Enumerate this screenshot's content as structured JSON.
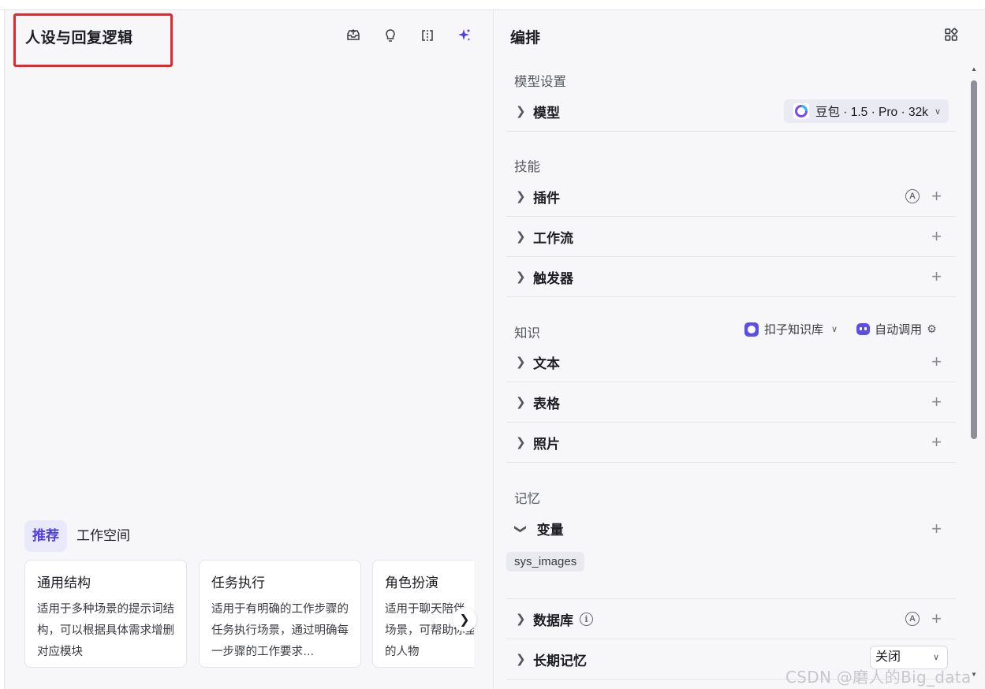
{
  "left": {
    "title": "人设与回复逻辑",
    "tabs": [
      "推荐",
      "工作空间"
    ],
    "cards": [
      {
        "title": "通用结构",
        "desc": "适用于多种场景的提示词结构，可以根据具体需求增删对应模块"
      },
      {
        "title": "任务执行",
        "desc": "适用于有明确的工作步骤的任务执行场景，通过明确每一步骤的工作要求…"
      },
      {
        "title": "角色扮演",
        "desc": "适用于聊天陪伴、互动娱乐场景，可帮助你塑造个性化的人物"
      }
    ],
    "icons": [
      "inbox-upload-icon",
      "bulb-icon",
      "split-view-icon",
      "sparkle-icon"
    ]
  },
  "right": {
    "title": "编排",
    "model_section": {
      "label": "模型设置",
      "row_label": "模型",
      "model_name": "豆包 · 1.5 · Pro · 32k"
    },
    "skills_section": {
      "label": "技能",
      "rows": [
        "插件",
        "工作流",
        "触发器"
      ]
    },
    "knowledge_section": {
      "label": "知识",
      "kb_name": "扣子知识库",
      "auto_call": "自动调用",
      "rows": [
        "文本",
        "表格",
        "照片"
      ]
    },
    "memory_section": {
      "label": "记忆",
      "variable_label": "变量",
      "variable_tag": "sys_images",
      "database_label": "数据库",
      "long_memory_label": "长期记忆",
      "long_memory_value": "关闭"
    },
    "auto_badge": "A",
    "info_badge": "i"
  },
  "watermark": "CSDN @磨人的Big_data",
  "colors": {
    "accent": "#4e40e5",
    "highlight_box": "#e8262b"
  }
}
